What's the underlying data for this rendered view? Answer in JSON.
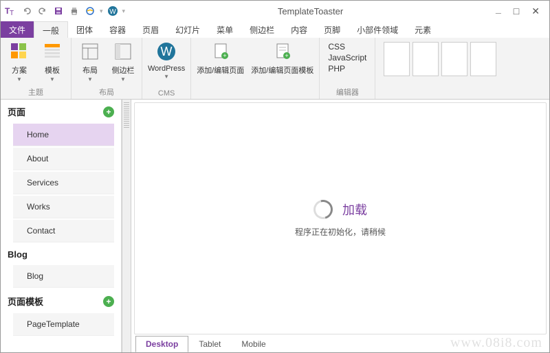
{
  "app": {
    "title": "TemplateToaster"
  },
  "qat": [
    "TT",
    "↶",
    "↷",
    "💾",
    "🖨",
    "e-icon",
    "wp"
  ],
  "tabs": {
    "file": "文件",
    "items": [
      "一般",
      "团体",
      "容器",
      "页眉",
      "幻灯片",
      "菜单",
      "侧边栏",
      "内容",
      "页脚",
      "小部件领域",
      "元素"
    ],
    "active": 0
  },
  "ribbon": {
    "groups": [
      {
        "label": "主题",
        "items": [
          {
            "label": "方案",
            "drop": true
          },
          {
            "label": "模板",
            "drop": true
          }
        ]
      },
      {
        "label": "布局",
        "items": [
          {
            "label": "布局",
            "drop": true
          },
          {
            "label": "侧边栏",
            "drop": true
          }
        ]
      },
      {
        "label": "CMS",
        "items": [
          {
            "label": "WordPress",
            "drop": true
          }
        ]
      },
      {
        "label": "",
        "items": [
          {
            "label": "添加/编辑页面"
          },
          {
            "label": "添加/编辑页面模板"
          }
        ]
      }
    ],
    "editor": {
      "label": "编辑器",
      "links": [
        "CSS",
        "JavaScript",
        "PHP"
      ]
    }
  },
  "sidebar": {
    "sections": [
      {
        "title": "页面",
        "add": true,
        "items": [
          "Home",
          "About",
          "Services",
          "Works",
          "Contact"
        ],
        "selected": 0
      },
      {
        "title": "Blog",
        "add": false,
        "items": [
          "Blog"
        ]
      },
      {
        "title": "页面模板",
        "add": true,
        "items": [
          "PageTemplate"
        ]
      }
    ]
  },
  "loading": {
    "title": "加载",
    "subtitle": "程序正在初始化，请稍候"
  },
  "viewtabs": {
    "items": [
      "Desktop",
      "Tablet",
      "Mobile"
    ],
    "active": 0
  },
  "watermark": "www.08i8.com"
}
